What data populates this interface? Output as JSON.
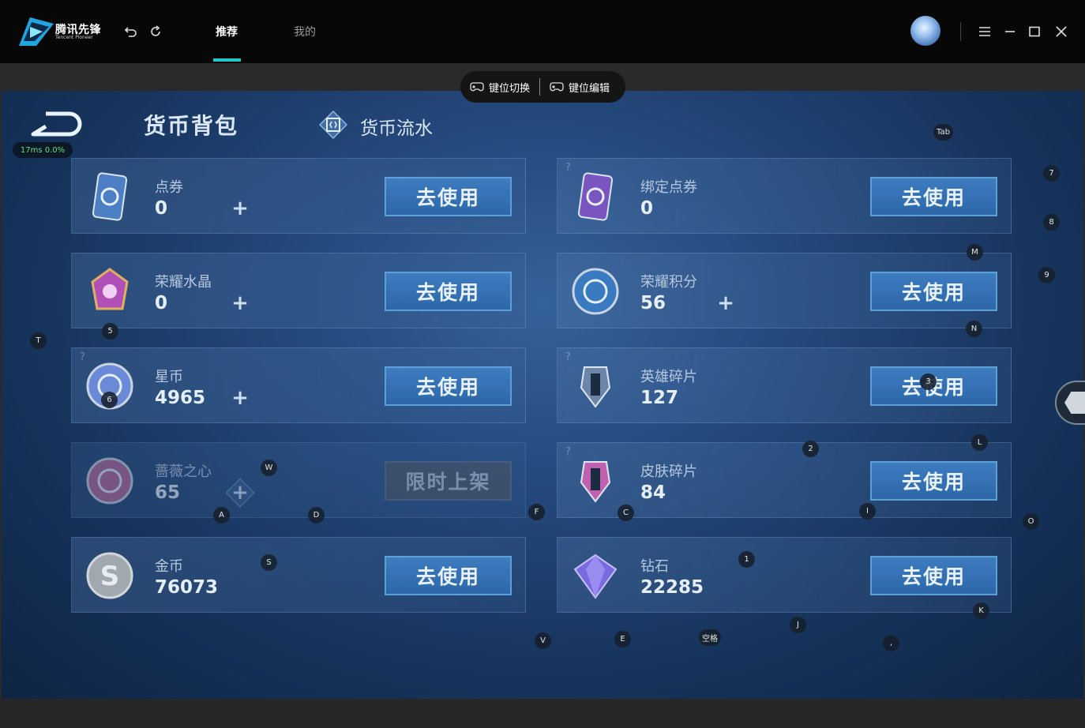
{
  "app": {
    "name": "腾讯先锋",
    "subtitle": "Tencent Pioneer",
    "tabs": [
      {
        "label": "推荐",
        "active": true
      },
      {
        "label": "我的",
        "active": false
      }
    ]
  },
  "toolbar": {
    "key_switch": "键位切换",
    "key_edit": "键位编辑"
  },
  "overlay": {
    "latency": "17ms",
    "loss": "0.0%"
  },
  "page": {
    "title": "货币背包",
    "flow_tab": "货币流水"
  },
  "cards": [
    {
      "name": "点券",
      "value": "0",
      "button": "去使用",
      "plus": true,
      "help": false,
      "icon": "ticket-card-icon",
      "color": "#4d7fc4"
    },
    {
      "name": "绑定点券",
      "value": "0",
      "button": "去使用",
      "plus": false,
      "help": true,
      "icon": "bound-ticket-card-icon",
      "color": "#7a55c0"
    },
    {
      "name": "荣耀水晶",
      "value": "0",
      "button": "去使用",
      "plus": true,
      "help": false,
      "icon": "glory-crystal-icon",
      "color": "#b04fb8"
    },
    {
      "name": "荣耀积分",
      "value": "56",
      "button": "去使用",
      "plus": true,
      "help": false,
      "icon": "glory-points-icon",
      "color": "#3a7ac0"
    },
    {
      "name": "星币",
      "value": "4965",
      "button": "去使用",
      "plus": true,
      "help": true,
      "icon": "star-coin-icon",
      "color": "#6a8ad8"
    },
    {
      "name": "英雄碎片",
      "value": "127",
      "button": "去使用",
      "plus": false,
      "help": true,
      "icon": "hero-fragment-icon",
      "color": "#6b86a8"
    },
    {
      "name": "蔷薇之心",
      "value": "65",
      "button": "限时上架",
      "plus": true,
      "help": false,
      "icon": "rose-heart-icon",
      "color": "#b86a9a",
      "disabled": true
    },
    {
      "name": "皮肤碎片",
      "value": "84",
      "button": "去使用",
      "plus": false,
      "help": true,
      "icon": "skin-fragment-icon",
      "color": "#c060b0"
    },
    {
      "name": "金币",
      "value": "76073",
      "button": "去使用",
      "plus": false,
      "help": false,
      "icon": "gold-coin-icon",
      "color": "#a0a8b0"
    },
    {
      "name": "钻石",
      "value": "22285",
      "button": "去使用",
      "plus": false,
      "help": false,
      "icon": "diamond-icon",
      "color": "#7a6ae0"
    }
  ],
  "key_markers": [
    "Tab",
    "7",
    "8",
    "M",
    "9",
    "T",
    "5",
    "N",
    "6",
    "3",
    "2",
    "L",
    "W",
    "A",
    "D",
    "F",
    "C",
    "I",
    "O",
    "S",
    "1",
    "V",
    "E",
    "空格",
    "J",
    ",",
    "K"
  ]
}
